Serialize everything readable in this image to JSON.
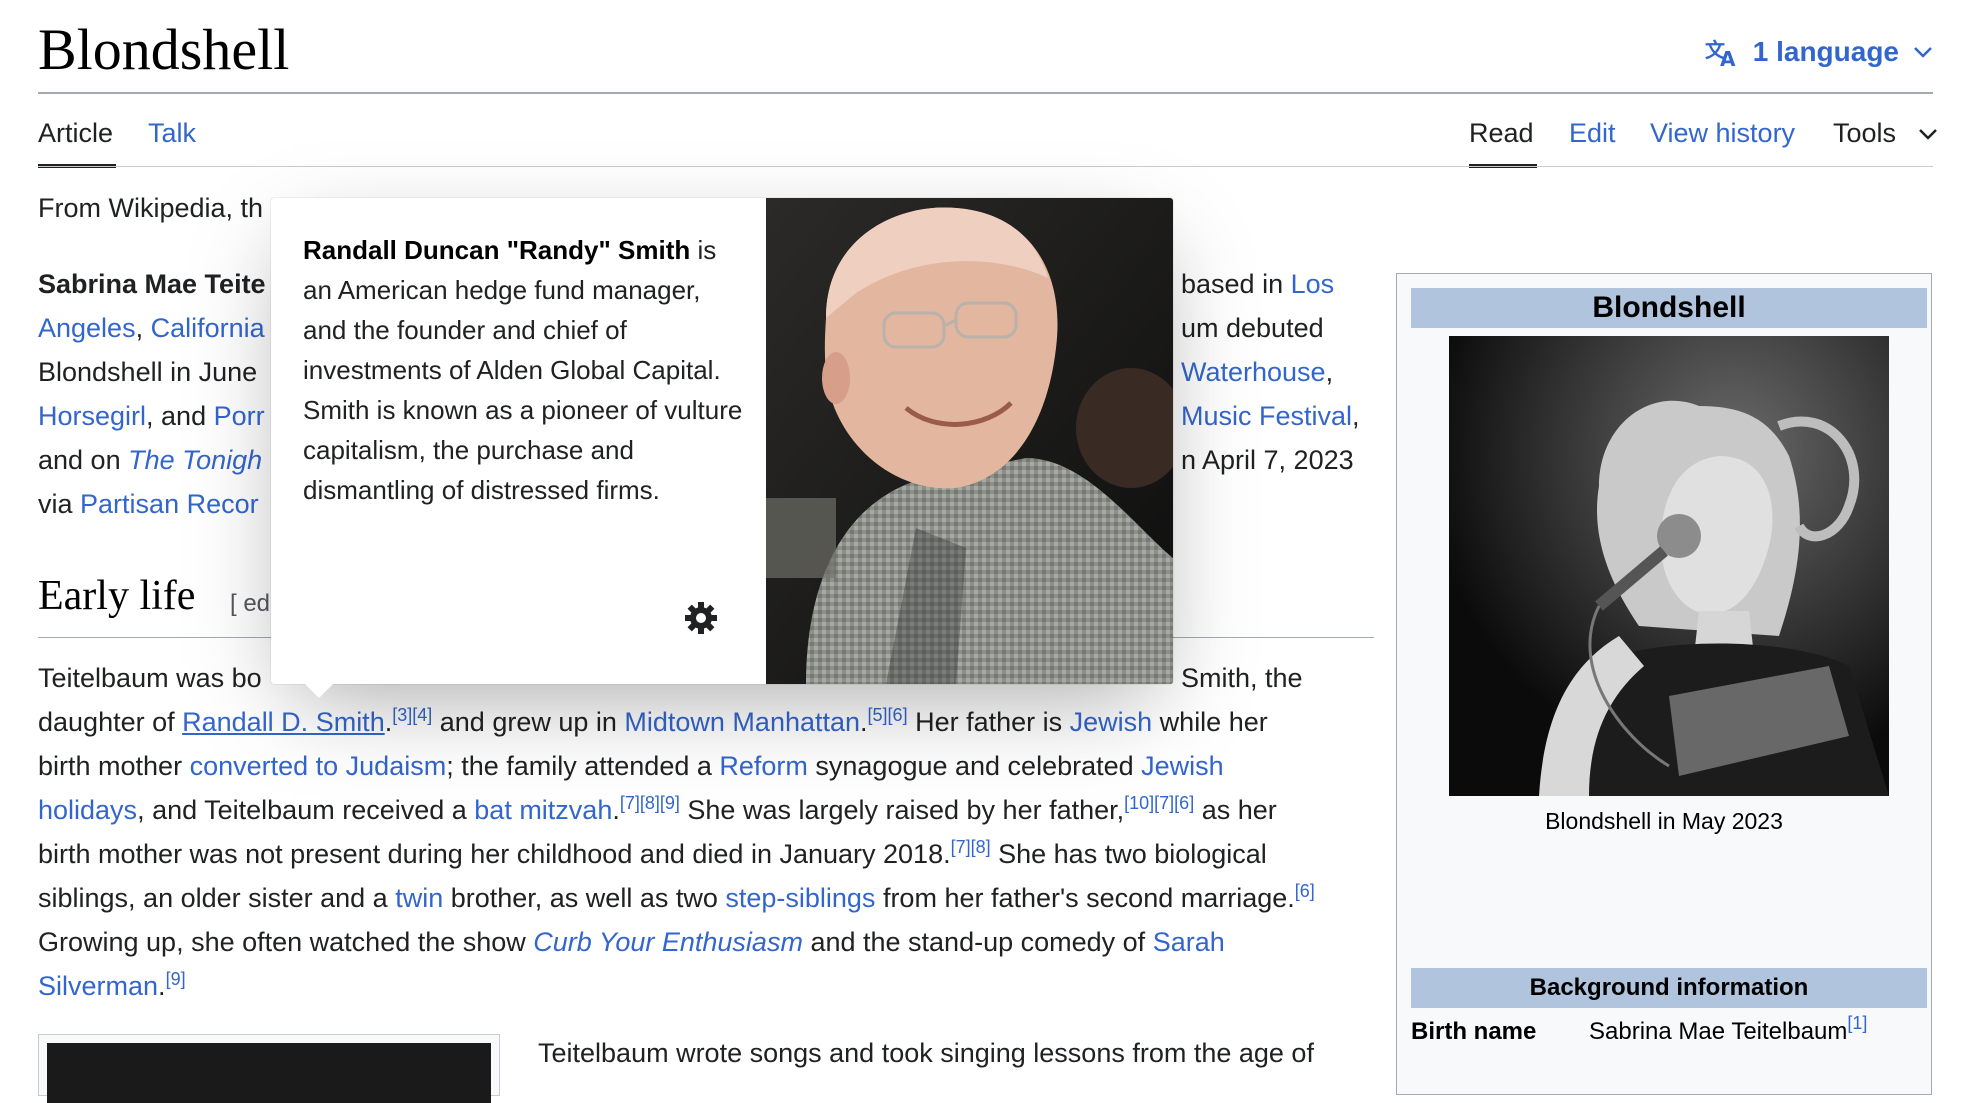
{
  "header": {
    "title": "Blondshell",
    "language_label": "1 language",
    "language_icon": "translate-icon"
  },
  "tabs": {
    "article": "Article",
    "talk": "Talk",
    "read": "Read",
    "edit": "Edit",
    "view_history": "View history",
    "tools": "Tools"
  },
  "intro": {
    "from": "From Wikipedia, th",
    "line1_bold": "Sabrina Mae Teite",
    "line1_tail_pre": "based in ",
    "line1_tail_link": "Los",
    "line2_a": "Angeles",
    "line2_sep": ", ",
    "line2_b": "California",
    "line2_tail": "um debuted",
    "line3_a": "Blondshell in June",
    "line3_tail_link": "Waterhouse",
    "line3_tail_after": ",",
    "line4_a": "Horsegirl",
    "line4_mid": ", and ",
    "line4_b": "Porr",
    "line4_tail_link": "Music Festival",
    "line4_tail_after": ",",
    "line5_a": "and on ",
    "line5_b": "The Tonigh",
    "line5_tail": "n April 7, 2023",
    "line6_a": "via ",
    "line6_b": "Partisan Recor"
  },
  "early_life": {
    "heading": "Early life",
    "edit_partial": "[ ed",
    "l1_a": "Teitelbaum was bo",
    "l1_tail": "Smith, the",
    "l2_a": "daughter of ",
    "l2_link_randall": "Randall D. Smith",
    "l2_p1": ".",
    "l2_ref1": "[3][4]",
    "l2_b": " and grew up in ",
    "l2_link_midtown": "Midtown Manhattan",
    "l2_p2": ".",
    "l2_ref2": "[5][6]",
    "l2_c": " Her father is ",
    "l2_link_jewish": "Jewish",
    "l2_d": " while her",
    "l3_a": "birth mother ",
    "l3_link_converted": "converted to Judaism",
    "l3_b": "; the family attended a ",
    "l3_link_reform": "Reform",
    "l3_c": " synagogue and celebrated ",
    "l3_link_jewish2": "Jewish",
    "l4_link_holidays": "holidays",
    "l4_a": ", and Teitelbaum received a ",
    "l4_link_bat": "bat mitzvah",
    "l4_p": ".",
    "l4_ref1": "[7][8][9]",
    "l4_b": " She was largely raised by her father,",
    "l4_ref2": "[10][7][6]",
    "l4_c": " as her",
    "l5_a": "birth mother was not present during her childhood and died in January 2018.",
    "l5_ref": "[7][8]",
    "l5_b": " She has two biological",
    "l6_a": "siblings, an older sister and a ",
    "l6_link_twin": "twin",
    "l6_b": " brother, as well as two ",
    "l6_link_step": "step-siblings",
    "l6_c": " from her father's second marriage.",
    "l6_ref": "[6]",
    "l7_a": "Growing up, she often watched the show ",
    "l7_link_curb": "Curb Your Enthusiasm",
    "l7_b": " and the stand-up comedy of ",
    "l7_link_sarah": "Sarah",
    "l8_link_silverman": "Silverman",
    "l8_p": ".",
    "l8_ref": "[9]",
    "l9": "Teitelbaum wrote songs and took singing lessons from the age of"
  },
  "infobox": {
    "title": "Blondshell",
    "caption": "Blondshell in May 2023",
    "section": "Background information",
    "birth_label": "Birth name",
    "birth_value": "Sabrina Mae Teitelbaum",
    "birth_ref": "[1]"
  },
  "popup": {
    "bold_name": "Randall Duncan \"Randy\" Smith",
    "extract": " is an American hedge fund manager, and the founder and chief of investments of Alden Global Capital. Smith is known as a pioneer of vulture capitalism, the purchase and dismantling of distressed firms.",
    "settings_icon": "gear-icon"
  },
  "colors": {
    "link": "#3366cc",
    "text": "#202122",
    "infobox_header": "#b0c4de"
  }
}
